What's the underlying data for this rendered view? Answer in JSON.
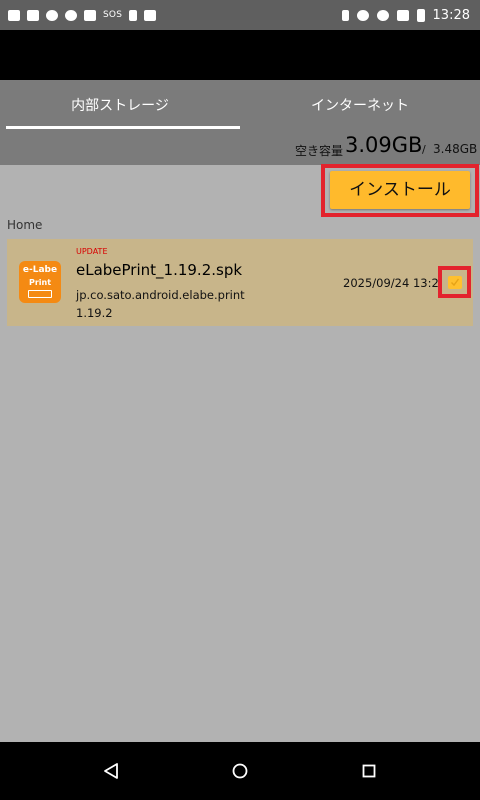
{
  "status_bar": {
    "sos_text": "SOS",
    "time": "13:28",
    "left_icons": [
      "print-icon",
      "image-icon",
      "cloud-icon",
      "cloud-upload-icon",
      "laptop-icon",
      "usb-icon",
      "font-icon"
    ],
    "right_icons": [
      "bluetooth-icon",
      "do-not-disturb-icon",
      "wifi-icon",
      "no-sim-icon",
      "battery-icon"
    ]
  },
  "tabs": [
    {
      "label": "内部ストレージ",
      "selected": true
    },
    {
      "label": "インターネット",
      "selected": false
    }
  ],
  "storage": {
    "label": "空き容量",
    "free": "3.09GB",
    "separator": "/",
    "total": "3.48GB"
  },
  "install_button": {
    "label": "インストール"
  },
  "breadcrumb": "Home",
  "files": [
    {
      "badge": "UPDATE",
      "icon_text_top": "e-Labe",
      "icon_text_bottom": "Print",
      "name": "eLabePrint_1.19.2.spk",
      "package": "jp.co.sato.android.elabe.print",
      "version": "1.19.2",
      "date": "2025/09/24 13:2",
      "checked": true
    }
  ],
  "colors": {
    "accent": "#ffba2c",
    "highlight": "#e3232d",
    "row_background": "#c8b58a",
    "badge": "#d80000"
  },
  "nav_bar": {
    "icons": [
      "back-icon",
      "home-icon",
      "recents-icon"
    ]
  }
}
